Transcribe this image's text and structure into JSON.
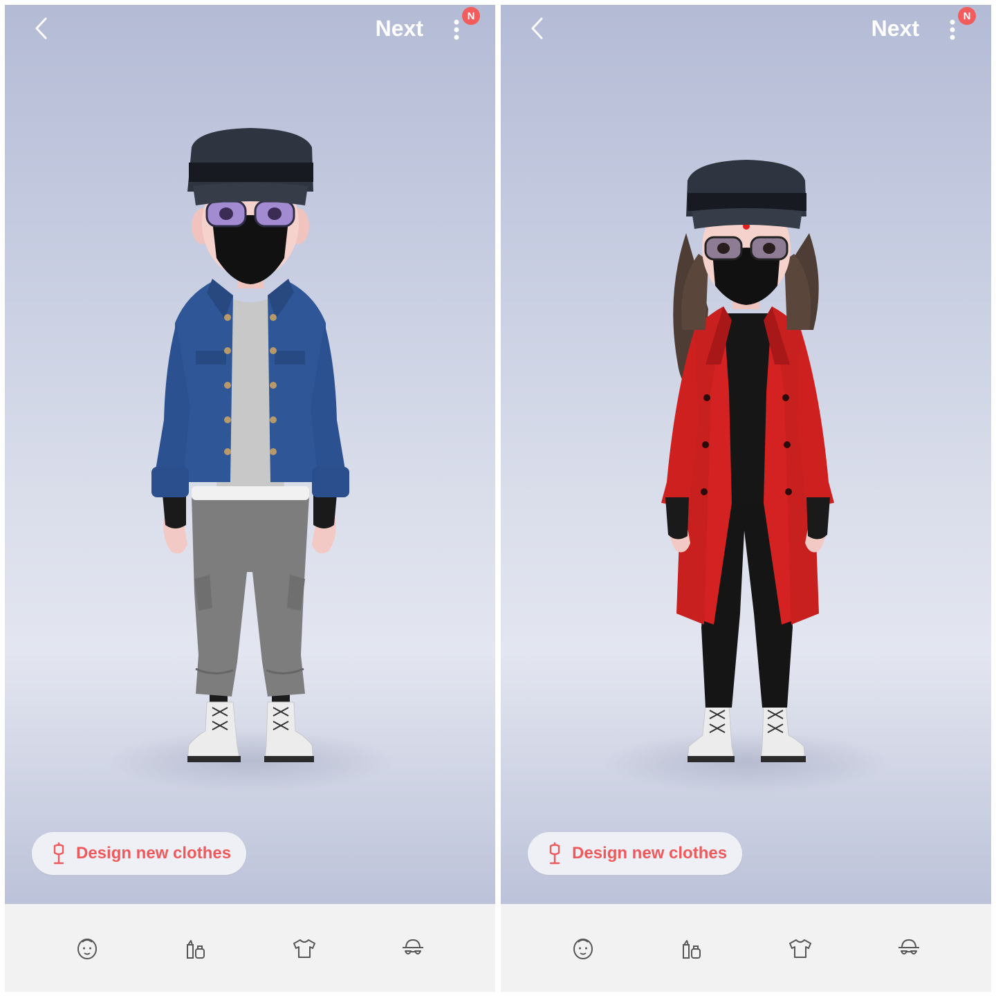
{
  "screens": [
    {
      "id": "left",
      "header": {
        "back_icon": "chevron-left-icon",
        "next_label": "Next",
        "more_icon": "more-vert-icon",
        "badge_text": "N"
      },
      "avatar": {
        "jacket": "denim-jacket",
        "top": "grey-sweater",
        "bottoms": "grey-cargo-joggers",
        "shoes": "white-lace-up-boots",
        "hat": "black-cap",
        "mask": "black-face-mask"
      },
      "design_button": {
        "icon": "mannequin-icon",
        "label": "Design new clothes"
      },
      "bottom_nav": [
        {
          "icon": "face-icon"
        },
        {
          "icon": "makeup-icon"
        },
        {
          "icon": "shirt-icon"
        },
        {
          "icon": "accessory-icon"
        }
      ]
    },
    {
      "id": "right",
      "header": {
        "back_icon": "chevron-left-icon",
        "next_label": "Next",
        "more_icon": "more-vert-icon",
        "badge_text": "N"
      },
      "avatar": {
        "coat": "red-double-breasted-coat",
        "top": "black-top",
        "bottoms": "black-leggings",
        "shoes": "white-lace-up-boots",
        "hat": "black-cap",
        "mask": "black-face-mask",
        "hair": "long-brown"
      },
      "design_button": {
        "icon": "mannequin-icon",
        "label": "Design new clothes"
      },
      "bottom_nav": [
        {
          "icon": "face-icon"
        },
        {
          "icon": "makeup-icon"
        },
        {
          "icon": "shirt-icon"
        },
        {
          "icon": "accessory-icon"
        }
      ]
    }
  ],
  "colors": {
    "accent": "#ee5a5c",
    "badge": "#f25c5c",
    "nav_bg": "#f2f2f3",
    "denim": "#2f5697",
    "coat": "#d42222"
  }
}
